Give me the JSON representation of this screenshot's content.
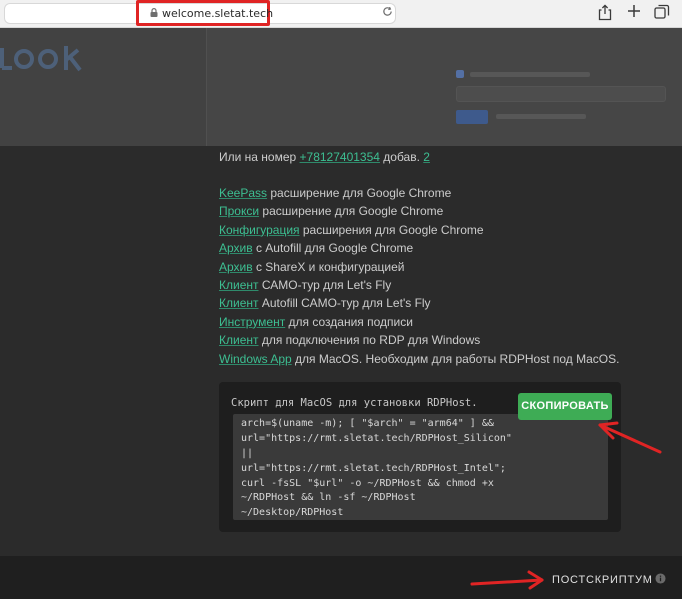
{
  "browser": {
    "url": "welcome.sletat.tech",
    "icons": [
      "lock-icon",
      "reload-icon",
      "share-icon",
      "plus-icon",
      "tabs-icon"
    ]
  },
  "page": {
    "phone_prefix": "Или на номер ",
    "phone_number": "+78127401354",
    "phone_ext_label": " добав. ",
    "phone_ext": "2",
    "links": [
      {
        "link": "KeePass",
        "text": " расширение для Google Chrome"
      },
      {
        "link": "Прокси",
        "text": " расширение для Google Chrome"
      },
      {
        "link": "Конфигурация",
        "text": " расширения для Google Chrome"
      },
      {
        "link": "Архив",
        "text": " с Autofill для Google Chrome"
      },
      {
        "link": "Архив",
        "text": " с ShareX и конфигурацией"
      },
      {
        "link": "Клиент",
        "text": " САМО-тур для Let's Fly"
      },
      {
        "link": "Клиент",
        "text": " Autofill САМО-тур для Let's Fly"
      },
      {
        "link": "Инструмент",
        "text": " для создания подписи"
      },
      {
        "link": "Клиент",
        "text": " для подключения по RDP для Windows"
      },
      {
        "link": "Windows App",
        "text": " для MacOS. Необходим для работы RDPHost под MacOS."
      }
    ]
  },
  "script_box": {
    "title": "Скрипт для MacOS для установки RDPHost.",
    "copy_label": "СКОПИРОВАТЬ",
    "code_lines": [
      "arch=$(uname -m); [ \"$arch\" = \"arm64\" ] &&",
      "url=\"https://rmt.sletat.tech/RDPHost_Silicon\"",
      "||",
      "url=\"https://rmt.sletat.tech/RDPHost_Intel\";",
      "curl -fsSL \"$url\" -o ~/RDPHost && chmod +x",
      "~/RDPHost && ln -sf ~/RDPHost",
      "~/Desktop/RDPHost"
    ]
  },
  "footer": {
    "label": "ПОСТСКРИПТУМ"
  },
  "colors": {
    "accent_link": "#3dbf92",
    "copy_button": "#3eac55",
    "annotation_red": "#e02424"
  }
}
